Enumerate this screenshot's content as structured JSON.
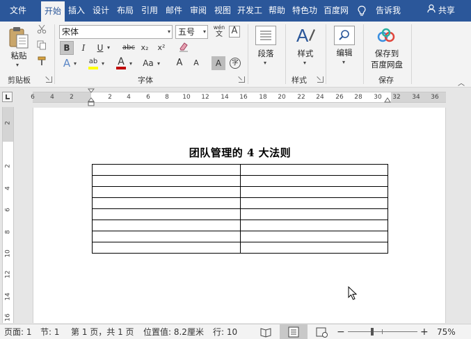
{
  "tabs": [
    {
      "label": "文件",
      "active": false
    },
    {
      "label": "开始",
      "active": true
    },
    {
      "label": "插入",
      "active": false
    },
    {
      "label": "设计",
      "active": false
    },
    {
      "label": "布局",
      "active": false
    },
    {
      "label": "引用",
      "active": false
    },
    {
      "label": "邮件",
      "active": false
    },
    {
      "label": "审阅",
      "active": false
    },
    {
      "label": "视图",
      "active": false
    },
    {
      "label": "开发工",
      "active": false
    },
    {
      "label": "帮助",
      "active": false
    },
    {
      "label": "特色功",
      "active": false
    },
    {
      "label": "百度网",
      "active": false
    }
  ],
  "tell_me": {
    "label": "告诉我",
    "icon": "lightbulb-icon"
  },
  "share": {
    "label": "共享",
    "icon": "person-icon"
  },
  "clipboard": {
    "paste_label": "粘贴",
    "group_label": "剪贴板"
  },
  "font": {
    "name_value": "宋体",
    "size_value": "五号",
    "group_label": "字体",
    "wen_label": "wén",
    "A_label": "A",
    "bold": "B",
    "italic": "I",
    "underline": "U",
    "strike": "abc",
    "sub": "x₂",
    "sup": "x²",
    "grow": "A",
    "shrink": "A",
    "case": "Aa",
    "shade": "A",
    "circle": "字"
  },
  "paragraph": {
    "label": "段落"
  },
  "styles": {
    "label": "样式",
    "group_label": "样式"
  },
  "editing": {
    "label": "编辑"
  },
  "save": {
    "line1": "保存到",
    "line2": "百度网盘",
    "group_label": "保存"
  },
  "ruler": {
    "ticks": [
      "6",
      "4",
      "2",
      "2",
      "4",
      "6",
      "8",
      "10",
      "12",
      "14",
      "16",
      "18",
      "20",
      "22",
      "24",
      "26",
      "28",
      "30",
      "32",
      "34",
      "36"
    ],
    "vticks": [
      "2",
      "2",
      "4",
      "6",
      "8",
      "10",
      "12",
      "14",
      "16"
    ]
  },
  "document": {
    "title": "团队管理的 4 大法则",
    "table_rows": 8,
    "table_cols": 2
  },
  "status": {
    "page": "页面: 1",
    "section": "节: 1",
    "pages": "第 1 页，共 1 页",
    "position": "位置值: 8.2厘米",
    "line": "行: 10",
    "zoom": "75%",
    "zoom_minus": "−",
    "zoom_plus": "+"
  },
  "colors": {
    "accent": "#2b579a",
    "font_color": "#c00000",
    "highlight": "#ffff00"
  }
}
